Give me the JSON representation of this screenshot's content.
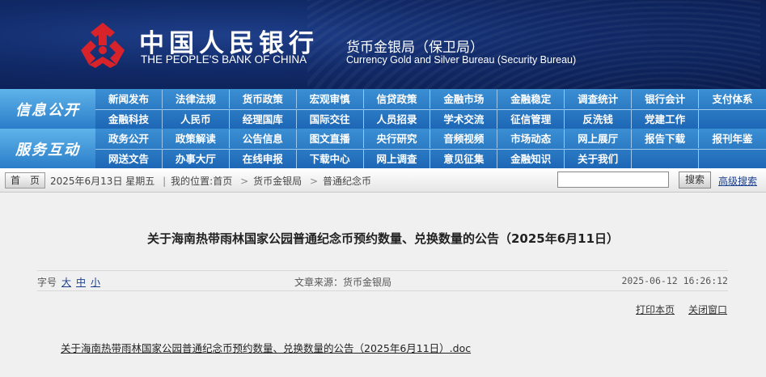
{
  "header": {
    "bank_name_cn": "中国人民银行",
    "bank_name_en": "THE PEOPLE'S BANK OF CHINA",
    "bureau_name_cn": "货币金银局（保卫局）",
    "bureau_name_en": "Currency  Gold and Silver Bureau (Security Bureau)",
    "logo_color": "#d8232a",
    "bg_color": "#112a68"
  },
  "nav": {
    "group1": {
      "label": "信息公开",
      "row1": [
        "新闻发布",
        "法律法规",
        "货币政策",
        "宏观审慎",
        "信贷政策",
        "金融市场",
        "金融稳定",
        "调查统计",
        "银行会计",
        "支付体系"
      ],
      "row2": [
        "金融科技",
        "人民币",
        "经理国库",
        "国际交往",
        "人员招录",
        "学术交流",
        "征信管理",
        "反洗钱",
        "党建工作",
        ""
      ]
    },
    "group2": {
      "label": "服务互动",
      "row1": [
        "政务公开",
        "政策解读",
        "公告信息",
        "图文直播",
        "央行研究",
        "音频视频",
        "市场动态",
        "网上展厅",
        "报告下载",
        "报刊年鉴"
      ],
      "row2": [
        "网送文告",
        "办事大厅",
        "在线申报",
        "下载中心",
        "网上调查",
        "意见征集",
        "金融知识",
        "关于我们",
        "",
        ""
      ]
    }
  },
  "crumbbar": {
    "home_label": "首　页",
    "date": "2025年6月13日",
    "weekday": "星期五",
    "location_prefix": "我的位置:",
    "crumb_home": "首页",
    "crumb_bureau": "货币金银局",
    "crumb_current": "普通纪念币",
    "search_value": "",
    "search_button": "搜索",
    "advanced_search": "高级搜索"
  },
  "article": {
    "title": "关于海南热带雨林国家公园普通纪念币预约数量、兑换数量的公告（2025年6月11日）",
    "fontsize_label": "字号",
    "fontsize_large": "大",
    "fontsize_medium": "中",
    "fontsize_small": "小",
    "source": "文章来源：货币金银局",
    "date": "2025-06-12 16:26:12",
    "print_label": "打印本页",
    "close_label": "关闭窗口",
    "attachment": "关于海南热带雨林国家公园普通纪念币预约数量、兑换数量的公告（2025年6月11日）.doc"
  }
}
